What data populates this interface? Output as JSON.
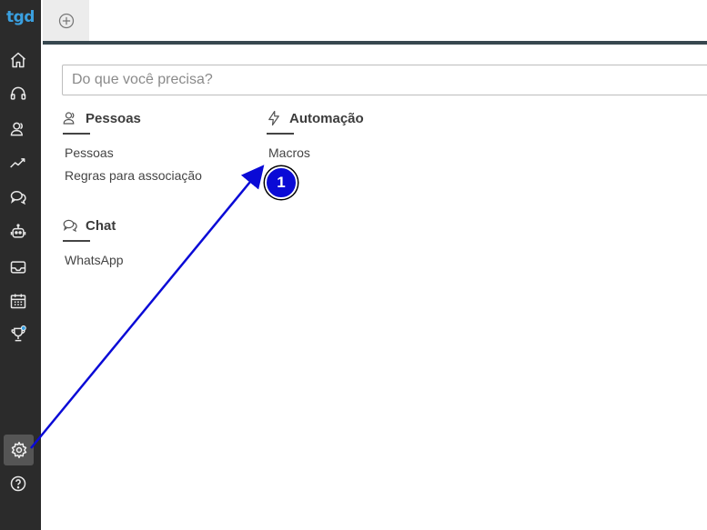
{
  "app": {
    "logo_text": "tgd"
  },
  "sidebar": {
    "icons": [
      "home-icon",
      "headset-icon",
      "users-icon",
      "trend-icon",
      "chat-bubbles-icon",
      "robot-icon",
      "inbox-icon",
      "calendar-icon",
      "trophy-icon"
    ],
    "bottom_icons": [
      "gear-icon",
      "help-icon"
    ]
  },
  "search": {
    "placeholder": "Do que você precisa?",
    "value": ""
  },
  "sections": {
    "pessoas": {
      "title": "Pessoas",
      "links": [
        "Pessoas",
        "Regras para associação"
      ]
    },
    "automacao": {
      "title": "Automação",
      "links": [
        "Macros"
      ]
    },
    "chat": {
      "title": "Chat",
      "links": [
        "WhatsApp"
      ]
    }
  },
  "annotation": {
    "step_number": "1",
    "arrow_color": "#0a0ad6"
  },
  "colors": {
    "sidebar_bg": "#2b2b2b",
    "accent_logo": "#3aa0e0",
    "topbar_line": "#37474f"
  }
}
